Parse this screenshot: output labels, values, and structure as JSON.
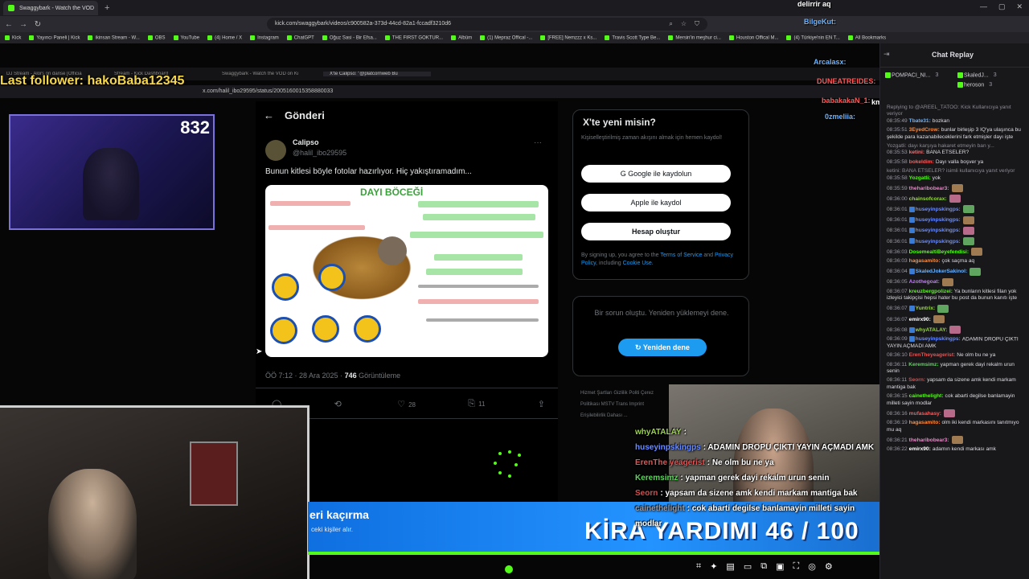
{
  "browser": {
    "tabs": [
      {
        "title": "Swaggybark - Watch the VOD"
      },
      {
        "title": "+"
      }
    ],
    "url": "kick.com/swaggybark/videos/c900582a-373d-44cd-82a1-fccadf3210d6",
    "bookmarks": [
      "Kick",
      "Yayıncı Paneli | Kick",
      "ikinsan Stream - W...",
      "OBS",
      "YouTube",
      "(4) Home / X",
      "Instagram",
      "ChatGPT",
      "Oğuz Sasi - Bir Efsa...",
      "THE FIRST GOKTUR...",
      "Albüm",
      "(1) Mepraz Offical -...",
      "[FREE] Nemzzz x Ks...",
      "Travis Scott Type Be...",
      "Mersin'in meşhur ci...",
      "Houston Offical M...",
      "(4) Türkiye'nin EN T...",
      "All Bookmarks"
    ]
  },
  "stream": {
    "last_follower": "Last follower: hakoBaba12345",
    "viewer_count": "832",
    "inner_tabs": [
      "DJ Stream - Alors on danse [Officia",
      "Stream - Kick Dashboard",
      "Swaggybark - Watch the VOD on Ki",
      "X'te Calipso: \"@platcornweb Bu"
    ],
    "inner_url": "x.com/halil_ibo29595/status/2005160015358880033",
    "tweet": {
      "header": "Gönderi",
      "name": "Calipso",
      "handle": "@halil_ibo29595",
      "text": "Bunun kitlesi böyle fotolar hazırlıyor. Hiç yakıştıramadım...",
      "meme_title": "DAYI BÖCEĞİ",
      "time": "ÖÖ 7:12 · 28 Ara 2025 · ",
      "views": "746",
      "views_label": " Görüntüleme",
      "retweets": "",
      "likes": "28",
      "bookmarks": "11"
    },
    "sidebar": {
      "title": "X'te yeni misin?",
      "subtitle": "Kişiselleştirilmiş zaman akışını almak için hemen kaydol!",
      "google": "Google ile kaydolun",
      "apple": "Apple ile kaydol",
      "create": "Hesap oluştur",
      "terms_a": "By signing up, you agree to the ",
      "terms_tos": "Terms of Service",
      "terms_b": " and ",
      "terms_pp": "Privacy Policy",
      "terms_c": ", including ",
      "terms_cu": "Cookie Use.",
      "error": "Bir sorun oluştu. Yeniden yüklemeyi dene.",
      "retry": "Yeniden dene",
      "footer": "Hizmet Şartları  Gizlilik Politi  Çerez Politikası  MSTV Trans  Imprint  Erişilebilirlik  Dahası ..."
    },
    "overlay_chat": [
      {
        "user": "whyATALAY",
        "color": "#9ad34b",
        "text": ":"
      },
      {
        "user": "huseyinpskingps",
        "color": "#6a8cff",
        "text": ": ADAMIN DROPU ÇIKTI YAYIN AÇMADI AMK"
      },
      {
        "user": "ErenThe yeagerist",
        "color": "#e05555",
        "text": ": Ne olm bu ne ya"
      },
      {
        "user": "Keremsimz",
        "color": "#5fd35f",
        "text": ": yapman gerek dayi rekalm urun senin"
      },
      {
        "user": "Seorn",
        "color": "#e04848",
        "text": ": yapsam da sizene amk kendi markam mantiga bak"
      },
      {
        "user": "cainethelight",
        "color": "#9a9aa3",
        "text": ": cok abarti degilse banlamayin milleti sayin modlar"
      }
    ],
    "banner_left": "eri kaçırma",
    "banner_left_sub": "ceki kişiler alır.",
    "banner_counter": "KİRA YARDIMI 46 / 100",
    "progress_pct": 100,
    "floating_names": [
      {
        "name": "delirrir aq",
        "color": "#ffffff"
      },
      {
        "name": "BilgeKut:",
        "color": "#6ab3ff"
      },
      {
        "name": "Arcalasx:",
        "color": "#6ab3ff"
      },
      {
        "name": "DUNEATREIDES:",
        "color": "#ff5a5a"
      },
      {
        "name": "babakakaN_1:",
        "color": "#ff5a5a"
      },
      {
        "name": "kmür adam ki m aq",
        "color": "#ffffff"
      },
      {
        "name": "0zmeliia:",
        "color": "#6ab3ff"
      }
    ]
  },
  "chat": {
    "title": "Chat Replay",
    "pinned": [
      {
        "user": "POMPACI_NI...",
        "count": "3"
      },
      {
        "user": "SkaledJ...",
        "count": "3"
      },
      {
        "user": "heroson",
        "count": "3"
      }
    ],
    "messages": [
      {
        "time": "08:35:49",
        "user": "Tbate31:",
        "color": "#6ab3ff",
        "text": "bozkan",
        "reply": "Replying to @AREEL_TATOO: Kick Kullanıcıya yanıt veriyor"
      },
      {
        "time": "08:35:51",
        "user": "3EyedCrow:",
        "color": "#ff8a3a",
        "text": "bunlar birleşip 3 IQ'ya ulaşınca bu şekilde para kazanabileceklerini fark etmişler dayı işte"
      },
      {
        "time": "08:35:53",
        "user": "ketini:",
        "color": "#ff6a6a",
        "text": "BANA ETSELER?",
        "reply": "Yozgatli: dayı karşıya hakaret etmeyin ban y..."
      },
      {
        "time": "08:35:58",
        "user": "bokeldim:",
        "color": "#ff5a5a",
        "text": "Dayı valla boşver ya"
      },
      {
        "time": "08:35:58",
        "user": "Yozgatli:",
        "color": "#53fc18",
        "text": "yok",
        "reply": "ketini: BANA ETSELER? isimli kullanıcıya yanıt veriyor"
      },
      {
        "time": "08:35:59",
        "user": "theharibobear3:",
        "color": "#ff7ad0",
        "text": ""
      },
      {
        "time": "08:36:00",
        "user": "chainsofcorax:",
        "color": "#9ad34b",
        "text": ""
      },
      {
        "time": "08:36:01",
        "user": "huseyinpskingps:",
        "color": "#6a8cff",
        "text": ""
      },
      {
        "time": "08:36:01",
        "user": "huseyinpskingps:",
        "color": "#6a8cff",
        "text": ""
      },
      {
        "time": "08:36:01",
        "user": "huseyinpskingps:",
        "color": "#6a8cff",
        "text": ""
      },
      {
        "time": "08:36:01",
        "user": "huseyinpskingps:",
        "color": "#6a8cff",
        "text": ""
      },
      {
        "time": "08:36:03",
        "user": "DosemealtiBeyefendisi:",
        "color": "#53fc18",
        "text": ""
      },
      {
        "time": "08:36:03",
        "user": "hagasamito:",
        "color": "#ff8a3a",
        "text": "çok saçma aq"
      },
      {
        "time": "08:36:04",
        "user": "SkaledJokerSakinol:",
        "color": "#6ab3ff",
        "text": ""
      },
      {
        "time": "08:36:05",
        "user": "Azothegoat:",
        "color": "#c47cff",
        "text": ""
      },
      {
        "time": "08:36:07",
        "user": "kreuzbergpolizei:",
        "color": "#53fc18",
        "text": "Ya bunların kitlesi filan yok izleyici takipçisi hepsi hater bu post da bunun kanıtı işte"
      },
      {
        "time": "08:36:07",
        "user": "Yuntrix:",
        "color": "#9ad34b",
        "text": ""
      },
      {
        "time": "08:36:07",
        "user": "emirx90:",
        "color": "#ffffff",
        "text": ""
      },
      {
        "time": "08:36:08",
        "user": "whyATALAY:",
        "color": "#9ad34b",
        "text": ""
      },
      {
        "time": "08:36:09",
        "user": "huseyinpskingps:",
        "color": "#6a8cff",
        "text": "ADAMIN DROPU ÇIKTI YAYIN AÇMADI AMK"
      },
      {
        "time": "08:36:10",
        "user": "ErenTheyeagerist:",
        "color": "#e05555",
        "text": "Ne olm bu ne ya"
      },
      {
        "time": "08:36:11",
        "user": "Keremsimz:",
        "color": "#5fd35f",
        "text": "yapman gerek dayi rekalm urun senin"
      },
      {
        "time": "08:36:11",
        "user": "Seorn:",
        "color": "#e04848",
        "text": "yapsam da sizene amk kendi markam mantiga bak"
      },
      {
        "time": "08:36:15",
        "user": "cainethelight:",
        "color": "#53fc18",
        "text": "cok abarti degilse banlamayin milleti sayin modlar"
      },
      {
        "time": "08:36:16",
        "user": "mufasahasy:",
        "color": "#ff5a5a",
        "text": ""
      },
      {
        "time": "08:36:19",
        "user": "hagasamito:",
        "color": "#ff8a3a",
        "text": "olm iki kendi markasını tanıtmıyo mu aq"
      },
      {
        "time": "08:36:21",
        "user": "theharibobear3:",
        "color": "#ff7ad0",
        "text": ""
      },
      {
        "time": "08:36:22",
        "user": "emirx90:",
        "color": "#ffffff",
        "text": "adamın kendi markası amk"
      }
    ]
  }
}
